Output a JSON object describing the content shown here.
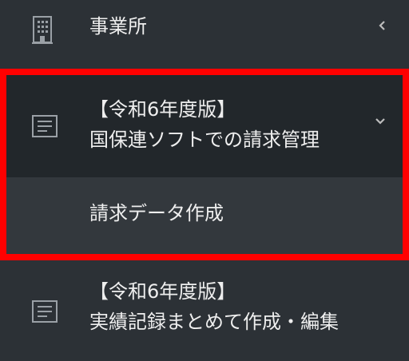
{
  "menu": {
    "office": {
      "icon": "building-icon",
      "label": "事業所",
      "chevron": "chevron-left-icon"
    },
    "billing": {
      "icon": "document-lines-icon",
      "label_line1": "【令和6年度版】",
      "label_line2": "国保連ソフトでの請求管理",
      "chevron": "chevron-down-icon",
      "expanded": true,
      "children": [
        {
          "label": "請求データ作成"
        }
      ]
    },
    "records": {
      "icon": "document-lines-icon",
      "label_line1": "【令和6年度版】",
      "label_line2": "実績記録まとめて作成・編集"
    }
  },
  "colors": {
    "background": "#2c3136",
    "expanded_bg": "#22272b",
    "child_bg": "#33383d",
    "highlight_border": "#ff0000",
    "text": "#eeeeee",
    "icon": "#9aa0a6"
  }
}
